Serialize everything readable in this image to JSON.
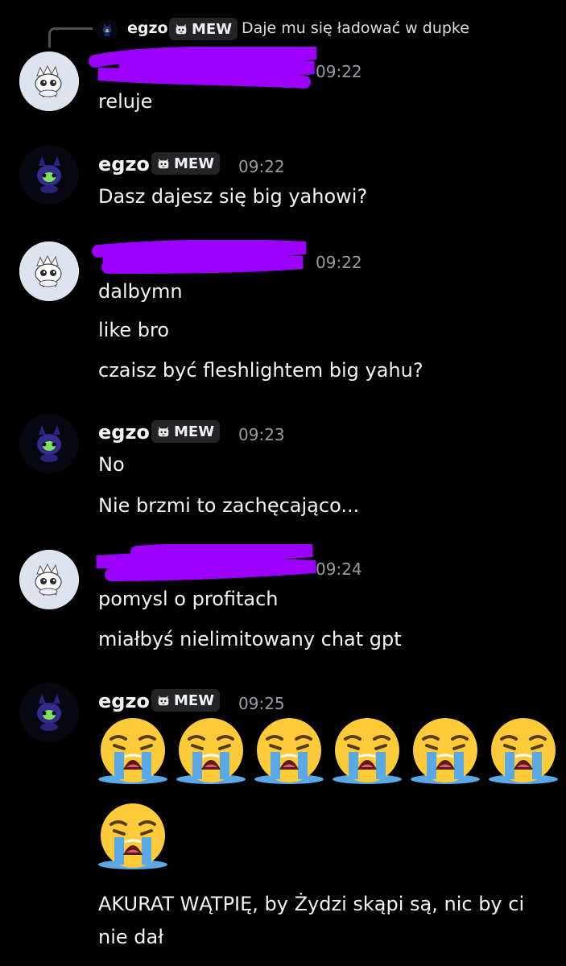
{
  "reply": {
    "author": "egzo",
    "tag": "MEW",
    "text": "Daje mu się ładować w dupke"
  },
  "messages": [
    {
      "author_redacted": true,
      "time": "09:22",
      "lines": [
        "reluje"
      ]
    },
    {
      "author": "egzo",
      "tag": "MEW",
      "time": "09:22",
      "lines": [
        "Dasz dajesz się big yahowi?"
      ]
    },
    {
      "author_redacted": true,
      "time": "09:22",
      "lines": [
        "dalbymn",
        "like bro",
        "czaisz być fleshlightem big yahu?"
      ]
    },
    {
      "author": "egzo",
      "tag": "MEW",
      "time": "09:23",
      "lines": [
        "No",
        "Nie brzmi to zachęcająco..."
      ]
    },
    {
      "author_redacted": true,
      "time": "09:24",
      "lines": [
        "pomysl o profitach",
        "miałbyś nielimitowany chat gpt"
      ]
    },
    {
      "author": "egzo",
      "tag": "MEW",
      "time": "09:25",
      "emoji": "loudly-crying-face",
      "emoji_count": 7,
      "lines": [
        "AKURAT WĄTPIĘ, by Żydzi skąpi są, nic by ci",
        "nie dał"
      ]
    }
  ],
  "colors": {
    "background": "#000000",
    "redaction": "#9b00ff",
    "timestamp": "#9a9ca3",
    "tag_bg": "#232428"
  }
}
